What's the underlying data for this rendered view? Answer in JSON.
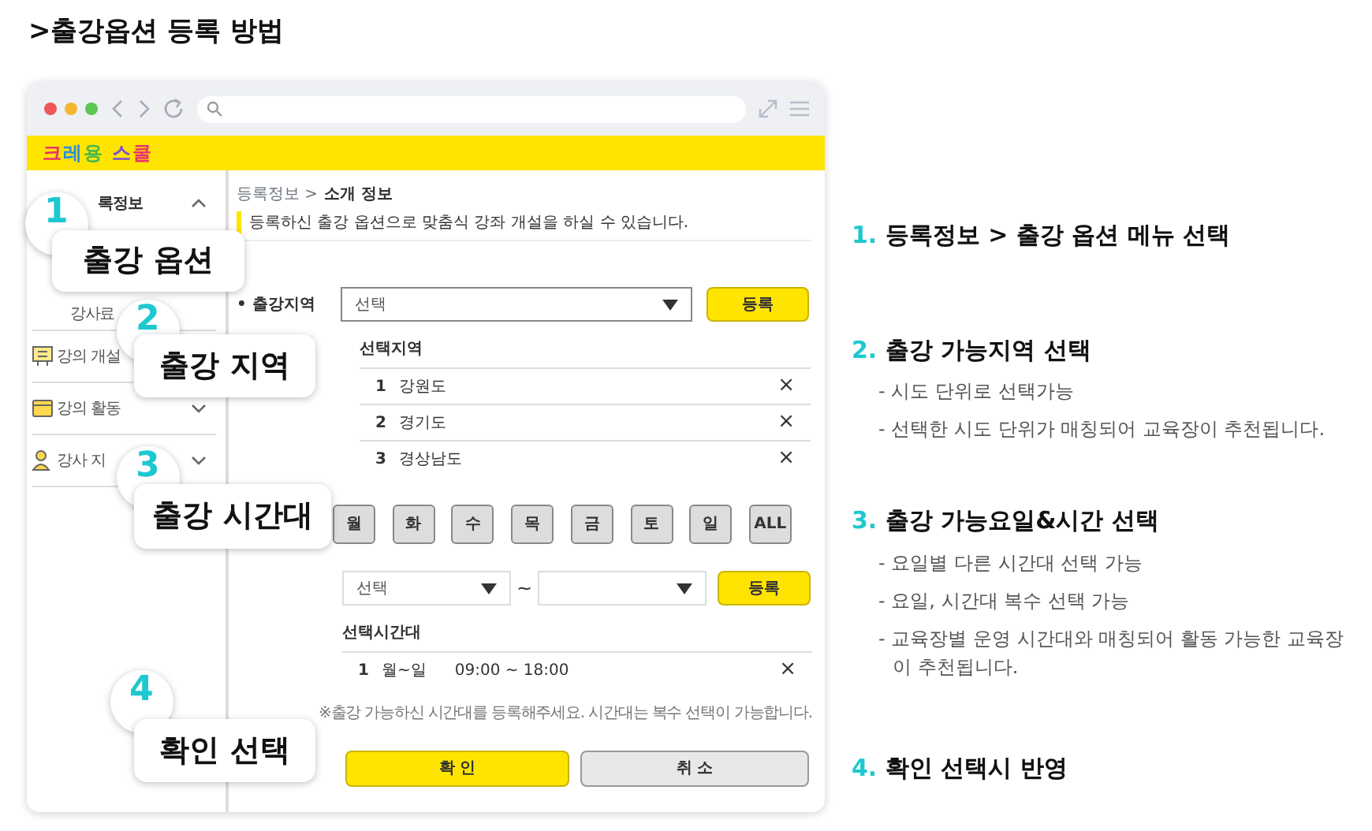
{
  "page_title": ">출강옵션 등록 방법",
  "mockup": {
    "logo": "크레용 스쿨",
    "sidebar": [
      {
        "label": "록정보",
        "kind": "header",
        "expanded": true
      },
      {
        "label": "강사료",
        "kind": "sub"
      },
      {
        "label": "강의 개설",
        "kind": "menu"
      },
      {
        "label": "강의 활동",
        "kind": "menu",
        "expanded": false
      },
      {
        "label": "강사 지",
        "kind": "menu",
        "expanded": false
      }
    ],
    "breadcrumb": {
      "parent": "등록정보 >",
      "current": "소개 정보"
    },
    "notice": "등록하신 출강 옵션으로 맞춤식 강좌 개설을 하실 수 있습니다.",
    "region": {
      "label": "• 출강지역",
      "select": "선택",
      "button": "등록",
      "list_title": "선택지역",
      "items": [
        {
          "num": "1",
          "name": "강원도",
          "remove": "×"
        },
        {
          "num": "2",
          "name": "경기도",
          "remove": "×"
        },
        {
          "num": "3",
          "name": "경상남도",
          "remove": "×"
        }
      ]
    },
    "days": [
      "월",
      "화",
      "수",
      "목",
      "금",
      "토",
      "일",
      "ALL"
    ],
    "time": {
      "from": "선택",
      "separator": "~",
      "button": "등록",
      "list_title": "선택시간대",
      "items": [
        {
          "num": "1",
          "days": "월~일",
          "range": "09:00 ~ 18:00",
          "remove": "×"
        }
      ]
    },
    "note": "※출강 가능하신 시간대를 등록해주세요. 시간대는 복수 선택이 가능합니다.",
    "actions": [
      {
        "label": "확 인",
        "kind": "primary"
      },
      {
        "label": "취 소",
        "kind": "secondary"
      }
    ]
  },
  "callouts": [
    {
      "number": "1",
      "label": "출강 옵션"
    },
    {
      "number": "2",
      "label": "출강 지역"
    },
    {
      "number": "3",
      "label": "출강 시간대"
    },
    {
      "number": "4",
      "label": "확인 선택"
    }
  ],
  "steps": [
    {
      "number": "1.",
      "title": "등록정보 > 출강 옵션 메뉴 선택"
    },
    {
      "number": "2.",
      "title": "출강 가능지역 선택",
      "notes": [
        "- 시도 단위로 선택가능",
        "- 선택한 시도 단위가 매칭되어 교육장이 추천됩니다."
      ]
    },
    {
      "number": "3.",
      "title": "출강 가능요일&시간 선택",
      "notes": [
        "- 요일별 다른 시간대 선택 가능",
        "- 요일, 시간대 복수 선택 가능",
        "- 교육장별 운영 시간대와 매칭되어 활동 가능한 교육장 이 추천됩니다."
      ]
    },
    {
      "number": "4.",
      "title": "확인 선택시 반영"
    }
  ]
}
